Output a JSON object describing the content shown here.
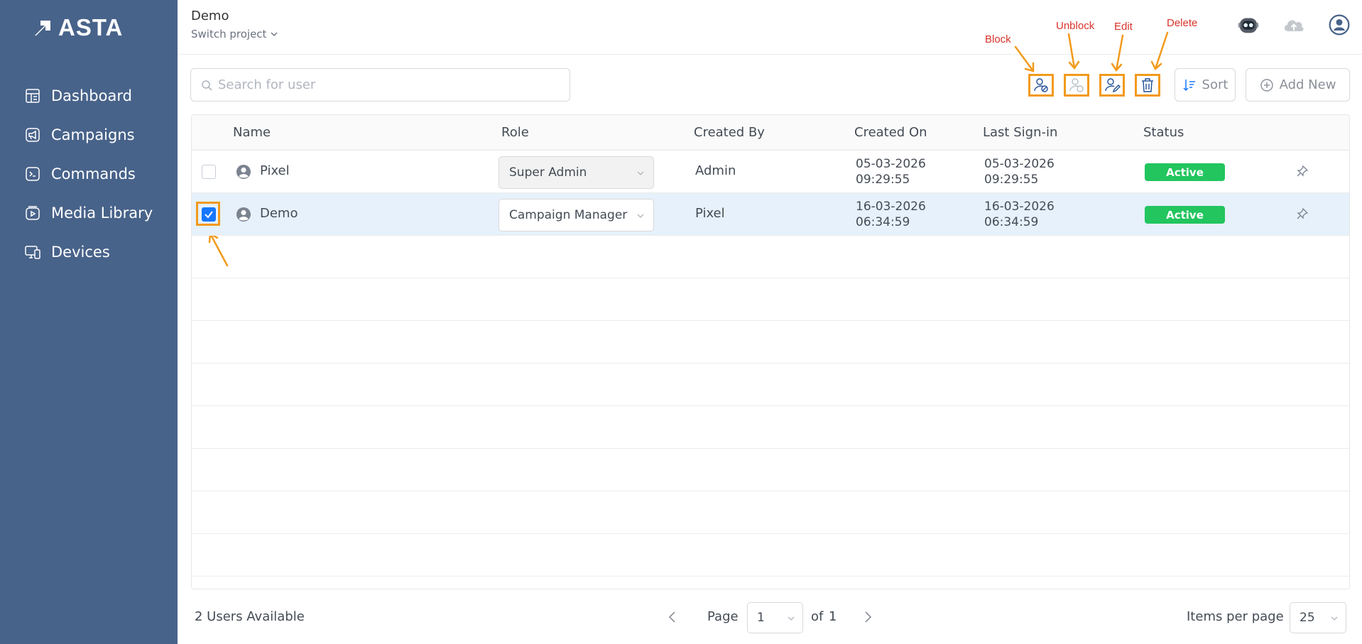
{
  "brand": {
    "name": "ASTA"
  },
  "sidebar": {
    "items": [
      {
        "label": "Dashboard",
        "icon": "dashboard-icon"
      },
      {
        "label": "Campaigns",
        "icon": "megaphone-icon"
      },
      {
        "label": "Commands",
        "icon": "terminal-icon"
      },
      {
        "label": "Media Library",
        "icon": "media-library-icon"
      },
      {
        "label": "Devices",
        "icon": "devices-icon"
      }
    ]
  },
  "header": {
    "project_name": "Demo",
    "switch_project": "Switch project"
  },
  "toolbar": {
    "search_placeholder": "Search for user",
    "sort_label": "Sort",
    "add_new_label": "Add New",
    "actions": [
      {
        "annotation": "Block",
        "icon": "block-user-icon"
      },
      {
        "annotation": "Unblock",
        "icon": "unblock-user-icon"
      },
      {
        "annotation": "Edit",
        "icon": "edit-user-icon"
      },
      {
        "annotation": "Delete",
        "icon": "trash-icon"
      }
    ]
  },
  "table": {
    "columns": [
      "Name",
      "Role",
      "Created By",
      "Created On",
      "Last Sign-in",
      "Status"
    ],
    "rows": [
      {
        "name": "Pixel",
        "role": "Super Admin",
        "created_by": "Admin",
        "created_on_date": "05-03-2026",
        "created_on_time": "09:29:55",
        "last_signin_date": "05-03-2026",
        "last_signin_time": "09:29:55",
        "status": "Active",
        "checked": false
      },
      {
        "name": "Demo",
        "role": "Campaign Manager",
        "created_by": "Pixel",
        "created_on_date": "16-03-2026",
        "created_on_time": "06:34:59",
        "last_signin_date": "16-03-2026",
        "last_signin_time": "06:34:59",
        "status": "Active",
        "checked": true
      }
    ]
  },
  "footer": {
    "users_count": "2 Users Available",
    "page_label": "Page",
    "page_current": "1",
    "page_of": "of",
    "page_total": "1",
    "items_per_page_label": "Items per page",
    "items_per_page": "25"
  },
  "colors": {
    "sidebar": "#48638a",
    "accent": "#1677ff",
    "status_active": "#22c55e",
    "annotation_box": "#f29a1b",
    "annotation_text": "#d9342b"
  }
}
